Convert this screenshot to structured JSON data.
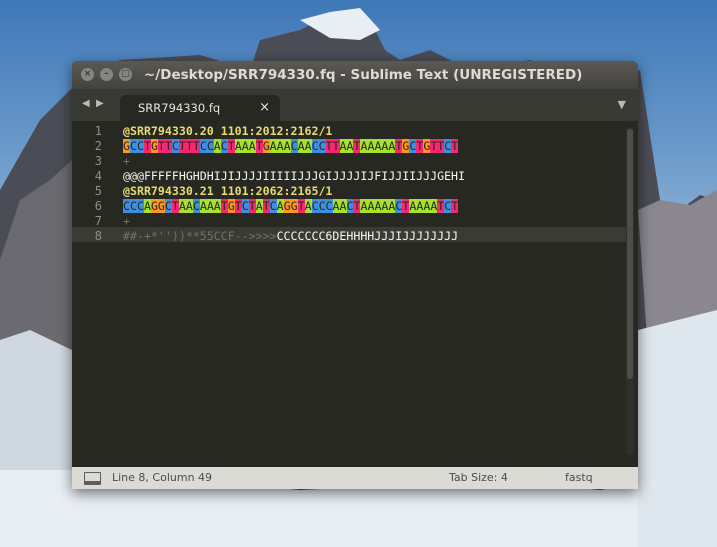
{
  "window": {
    "title": "~/Desktop/SRR794330.fq - Sublime Text (UNREGISTERED)",
    "controls": [
      "×",
      "–",
      "□"
    ]
  },
  "tabs": {
    "nav_back": "◀",
    "nav_forward": "▶",
    "active_tab": "SRR794330.fq",
    "close": "×",
    "menu": "▼"
  },
  "editor": {
    "lines": [
      {
        "num": "1",
        "kind": "header",
        "text": "@SRR794330.20 1101:2012:2162/1"
      },
      {
        "num": "2",
        "kind": "seq",
        "text": "GCCTGTTCTTTCCACTAAATGAAACAACCTTAATAAAAATGCTGTTCT"
      },
      {
        "num": "3",
        "kind": "plus",
        "text": "+"
      },
      {
        "num": "4",
        "kind": "qual",
        "text": "@@@FFFFFHGHDHIJIJJJJIIIIIJJJGIJJJJIJFIJJIIJJJGEHI"
      },
      {
        "num": "5",
        "kind": "header",
        "text": "@SRR794330.21 1101:2062:2165/1"
      },
      {
        "num": "6",
        "kind": "seq",
        "text": "CCCAGGCTAACAAATGTCTATCAGGTACCCAACTAAAAACTAAAATCT"
      },
      {
        "num": "7",
        "kind": "plus",
        "text": "+"
      },
      {
        "num": "8",
        "kind": "qual-dim",
        "text": "##-+*''))**55CCF-->>>>CCCCCCC6DEHHHHJJJIJJJJJJJJ"
      }
    ],
    "current_line": 8
  },
  "status": {
    "position": "Line 8, Column 49",
    "tab_size": "Tab Size: 4",
    "syntax": "fastq"
  },
  "colors": {
    "A": "#a6e22e",
    "C": "#3e8fe0",
    "G": "#fd971f",
    "T": "#f92672"
  }
}
